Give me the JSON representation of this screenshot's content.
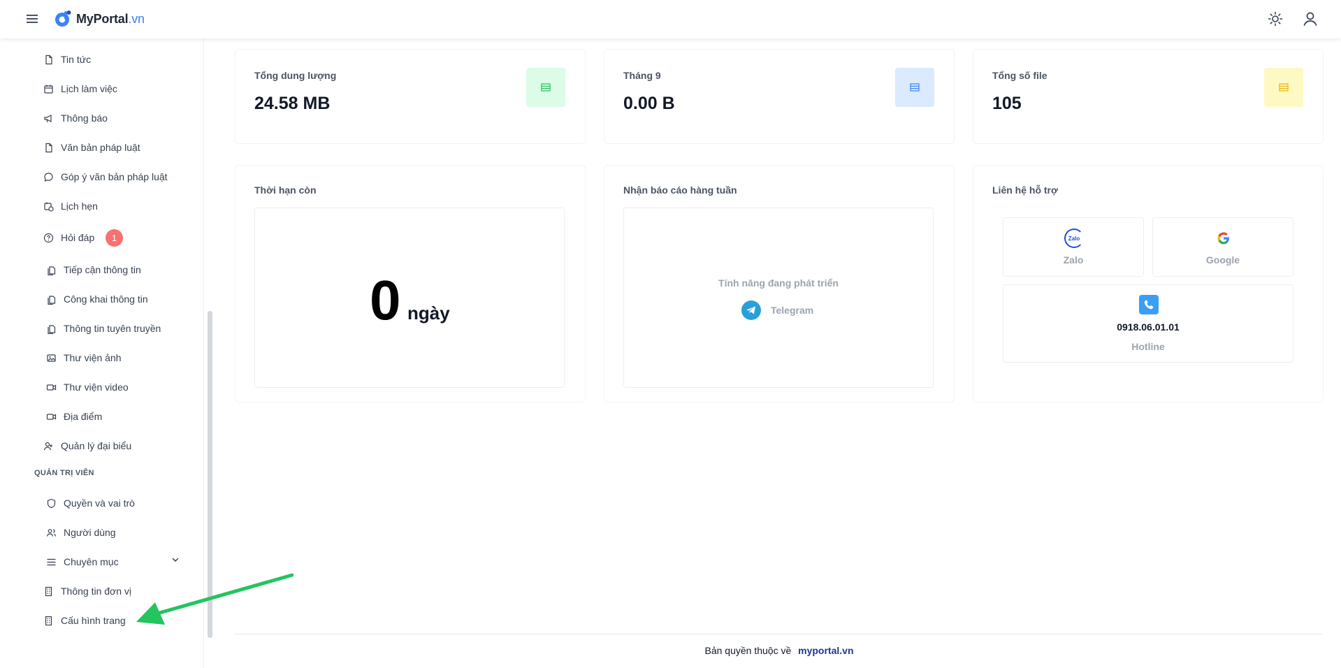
{
  "header": {
    "logo_name": "MyPortal",
    "logo_tld": ".vn"
  },
  "sidebar": {
    "items": [
      {
        "label": "Tin tức",
        "icon": "document-icon"
      },
      {
        "label": "Lịch làm việc",
        "icon": "calendar-icon"
      },
      {
        "label": "Thông báo",
        "icon": "megaphone-icon"
      },
      {
        "label": "Văn bản pháp luật",
        "icon": "document-icon"
      },
      {
        "label": "Góp ý văn bản pháp luật",
        "icon": "chat-icon"
      },
      {
        "label": "Lịch hẹn",
        "icon": "calendar-clock-icon"
      },
      {
        "label": "Hỏi đáp",
        "icon": "question-icon",
        "badge": "1"
      },
      {
        "label": "Tiếp cận thông tin",
        "icon": "files-icon"
      },
      {
        "label": "Công khai thông tin",
        "icon": "files-icon"
      },
      {
        "label": "Thông tin tuyên truyền",
        "icon": "files-icon"
      },
      {
        "label": "Thư viện ảnh",
        "icon": "image-icon"
      },
      {
        "label": "Thư viện video",
        "icon": "video-icon"
      },
      {
        "label": "Địa điểm",
        "icon": "video-icon"
      },
      {
        "label": "Quản lý đại biểu",
        "icon": "user-icon"
      }
    ],
    "admin_section": "QUẢN TRỊ VIÊN",
    "admin_items": [
      {
        "label": "Quyền và vai trò",
        "icon": "shield-icon"
      },
      {
        "label": "Người dùng",
        "icon": "users-icon"
      },
      {
        "label": "Chuyên mục",
        "icon": "list-icon"
      },
      {
        "label": "Thông tin đơn vị",
        "icon": "building-icon"
      },
      {
        "label": "Cấu hình trang",
        "icon": "building-icon"
      }
    ]
  },
  "stats": [
    {
      "label": "Tổng dung lượng",
      "value": "24.58 MB",
      "color": "#dcfce7",
      "icon_color": "#22c55e"
    },
    {
      "label": "Tháng 9",
      "value": "0.00 B",
      "color": "#dbeafe",
      "icon_color": "#3b82f6"
    },
    {
      "label": "Tổng số file",
      "value": "105",
      "color": "#fef9c3",
      "icon_color": "#eab308"
    }
  ],
  "remaining": {
    "title": "Thời hạn còn",
    "days": "0",
    "unit": "ngày"
  },
  "weekly": {
    "title": "Nhận báo cáo hàng tuần",
    "status": "Tính năng đang phát triển",
    "channel": "Telegram"
  },
  "support": {
    "title": "Liên hệ hỗ trợ",
    "zalo": "Zalo",
    "zalo_logo": "Zalo",
    "google": "Google",
    "phone": "0918.06.01.01",
    "hotline": "Hotline"
  },
  "footer": {
    "text": "Bản quyền thuộc về",
    "link": "myportal.vn"
  }
}
